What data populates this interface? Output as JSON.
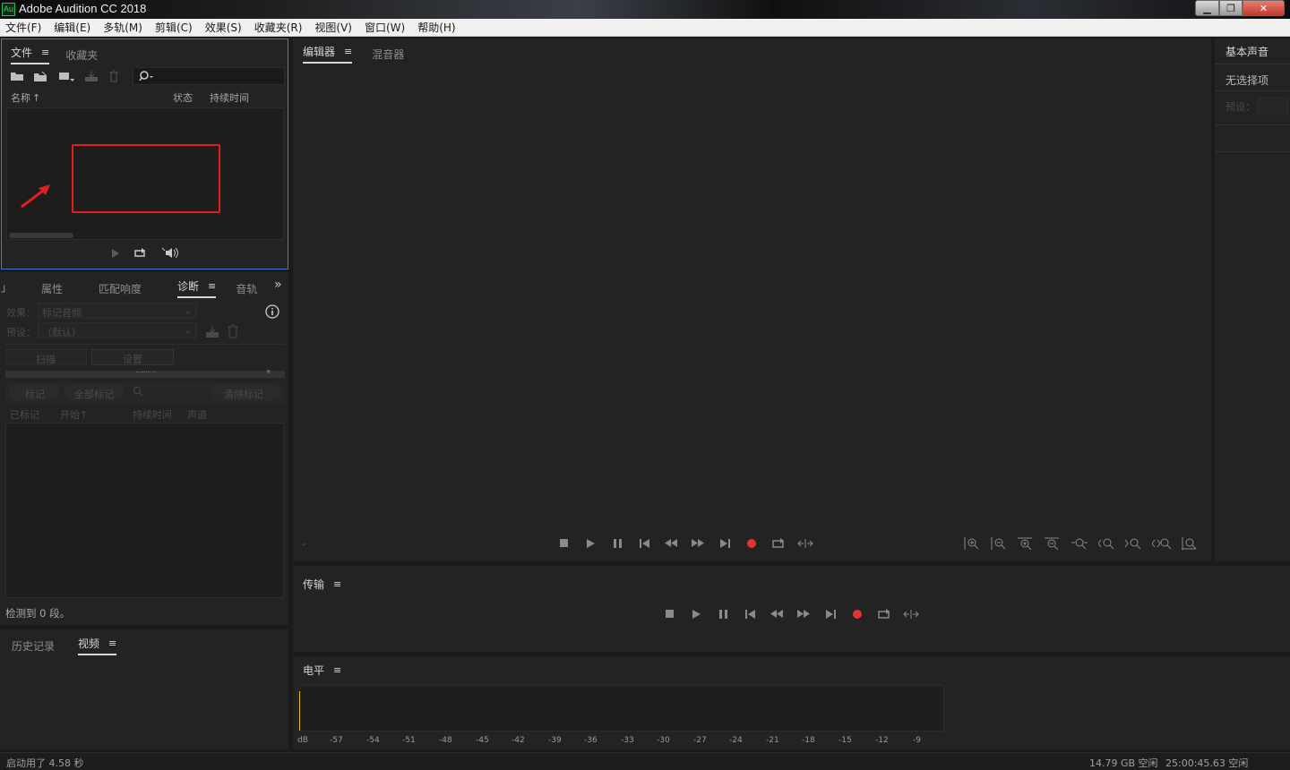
{
  "window": {
    "title": "Adobe Audition CC 2018",
    "app_icon": "Au"
  },
  "menu": [
    "文件(F)",
    "编辑(E)",
    "多轨(M)",
    "剪辑(C)",
    "效果(S)",
    "收藏夹(R)",
    "视图(V)",
    "窗口(W)",
    "帮助(H)"
  ],
  "files_panel": {
    "tabs": [
      "文件",
      "收藏夹"
    ],
    "menu_glyph": "≡",
    "columns": {
      "name": "名称",
      "sort": "↑",
      "status": "状态",
      "duration": "持续时间"
    }
  },
  "diag_panel": {
    "tabs": [
      "属性",
      "匹配响度",
      "诊断",
      "音轨"
    ],
    "edge_left": "」",
    "more": "»",
    "effect_label": "效果：",
    "effect_value": "标记音频",
    "preset_label": "预设：",
    "preset_value": "（默认）",
    "scan": "扫描",
    "settings": "设置",
    "mark": "标记",
    "mark_all": "全部标记",
    "clear_marks": "清除标记",
    "col_marked": "已标记",
    "col_start": "开始",
    "col_duration": "持续时间",
    "col_channel": "声道",
    "detected": "检测到 0 段。"
  },
  "history_panel": {
    "tabs": [
      "历史记录",
      "视频"
    ]
  },
  "editor_panel": {
    "tabs": [
      "编辑器",
      "混音器"
    ],
    "dash": "-"
  },
  "transport_panel": {
    "title": "传输"
  },
  "level_panel": {
    "title": "电平",
    "scale": [
      "dB",
      "-57",
      "-54",
      "-51",
      "-48",
      "-45",
      "-42",
      "-39",
      "-36",
      "-33",
      "-30",
      "-27",
      "-24",
      "-21",
      "-18",
      "-15",
      "-12",
      "-9"
    ]
  },
  "essential_sound": {
    "title": "基本声音",
    "no_selection": "无选择项",
    "preset_label": "预设："
  },
  "status": {
    "launch": "启动用了 4.58 秒",
    "disk_free": "14.79 GB 空闲",
    "time_free": "25:00:45.63 空闲"
  },
  "colors": {
    "record": "#e0352f",
    "highlight_box": "#e0201c",
    "panel": "#232323",
    "focus_border": "#3a7bd5"
  }
}
